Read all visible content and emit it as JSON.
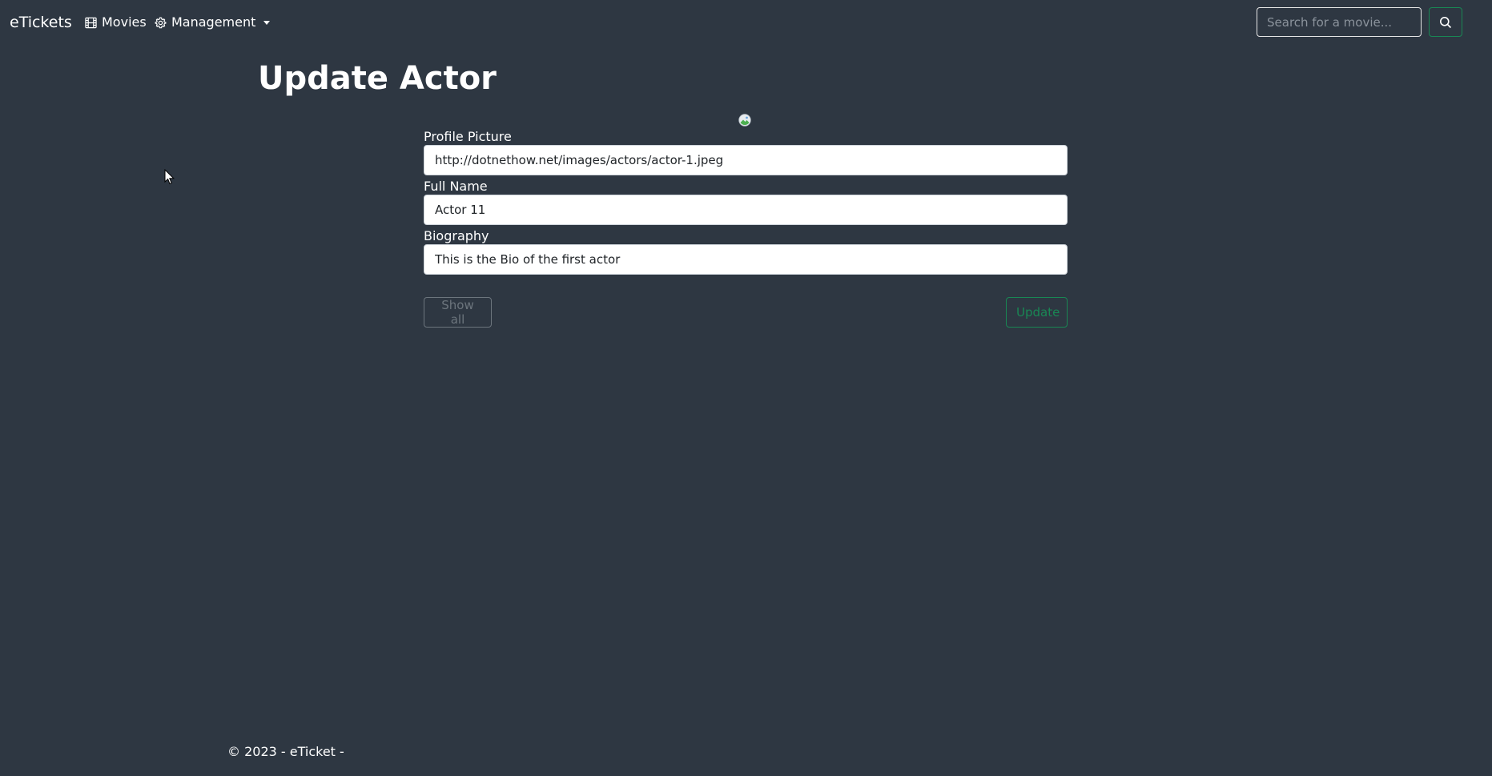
{
  "navbar": {
    "brand": "eTickets",
    "movies_label": "Movies",
    "management_label": "Management",
    "movies_icon": "film-icon",
    "management_icon": "gear-icon",
    "search": {
      "placeholder": "Search for a movie...",
      "value": "",
      "button_icon": "search-icon"
    }
  },
  "page": {
    "title": "Update Actor",
    "profile_image_icon": "broken-image-icon"
  },
  "form": {
    "profile_picture": {
      "label": "Profile Picture",
      "value": "http://dotnethow.net/images/actors/actor-1.jpeg"
    },
    "full_name": {
      "label": "Full Name",
      "value": "Actor 11"
    },
    "biography": {
      "label": "Biography",
      "value": "This is the Bio of the first actor"
    },
    "show_all_label": "Show all",
    "update_label": "Update"
  },
  "footer": {
    "text": "© 2023 - eTicket -"
  },
  "colors": {
    "background": "#2e3742",
    "success": "#198754",
    "secondary": "#6c757d"
  }
}
